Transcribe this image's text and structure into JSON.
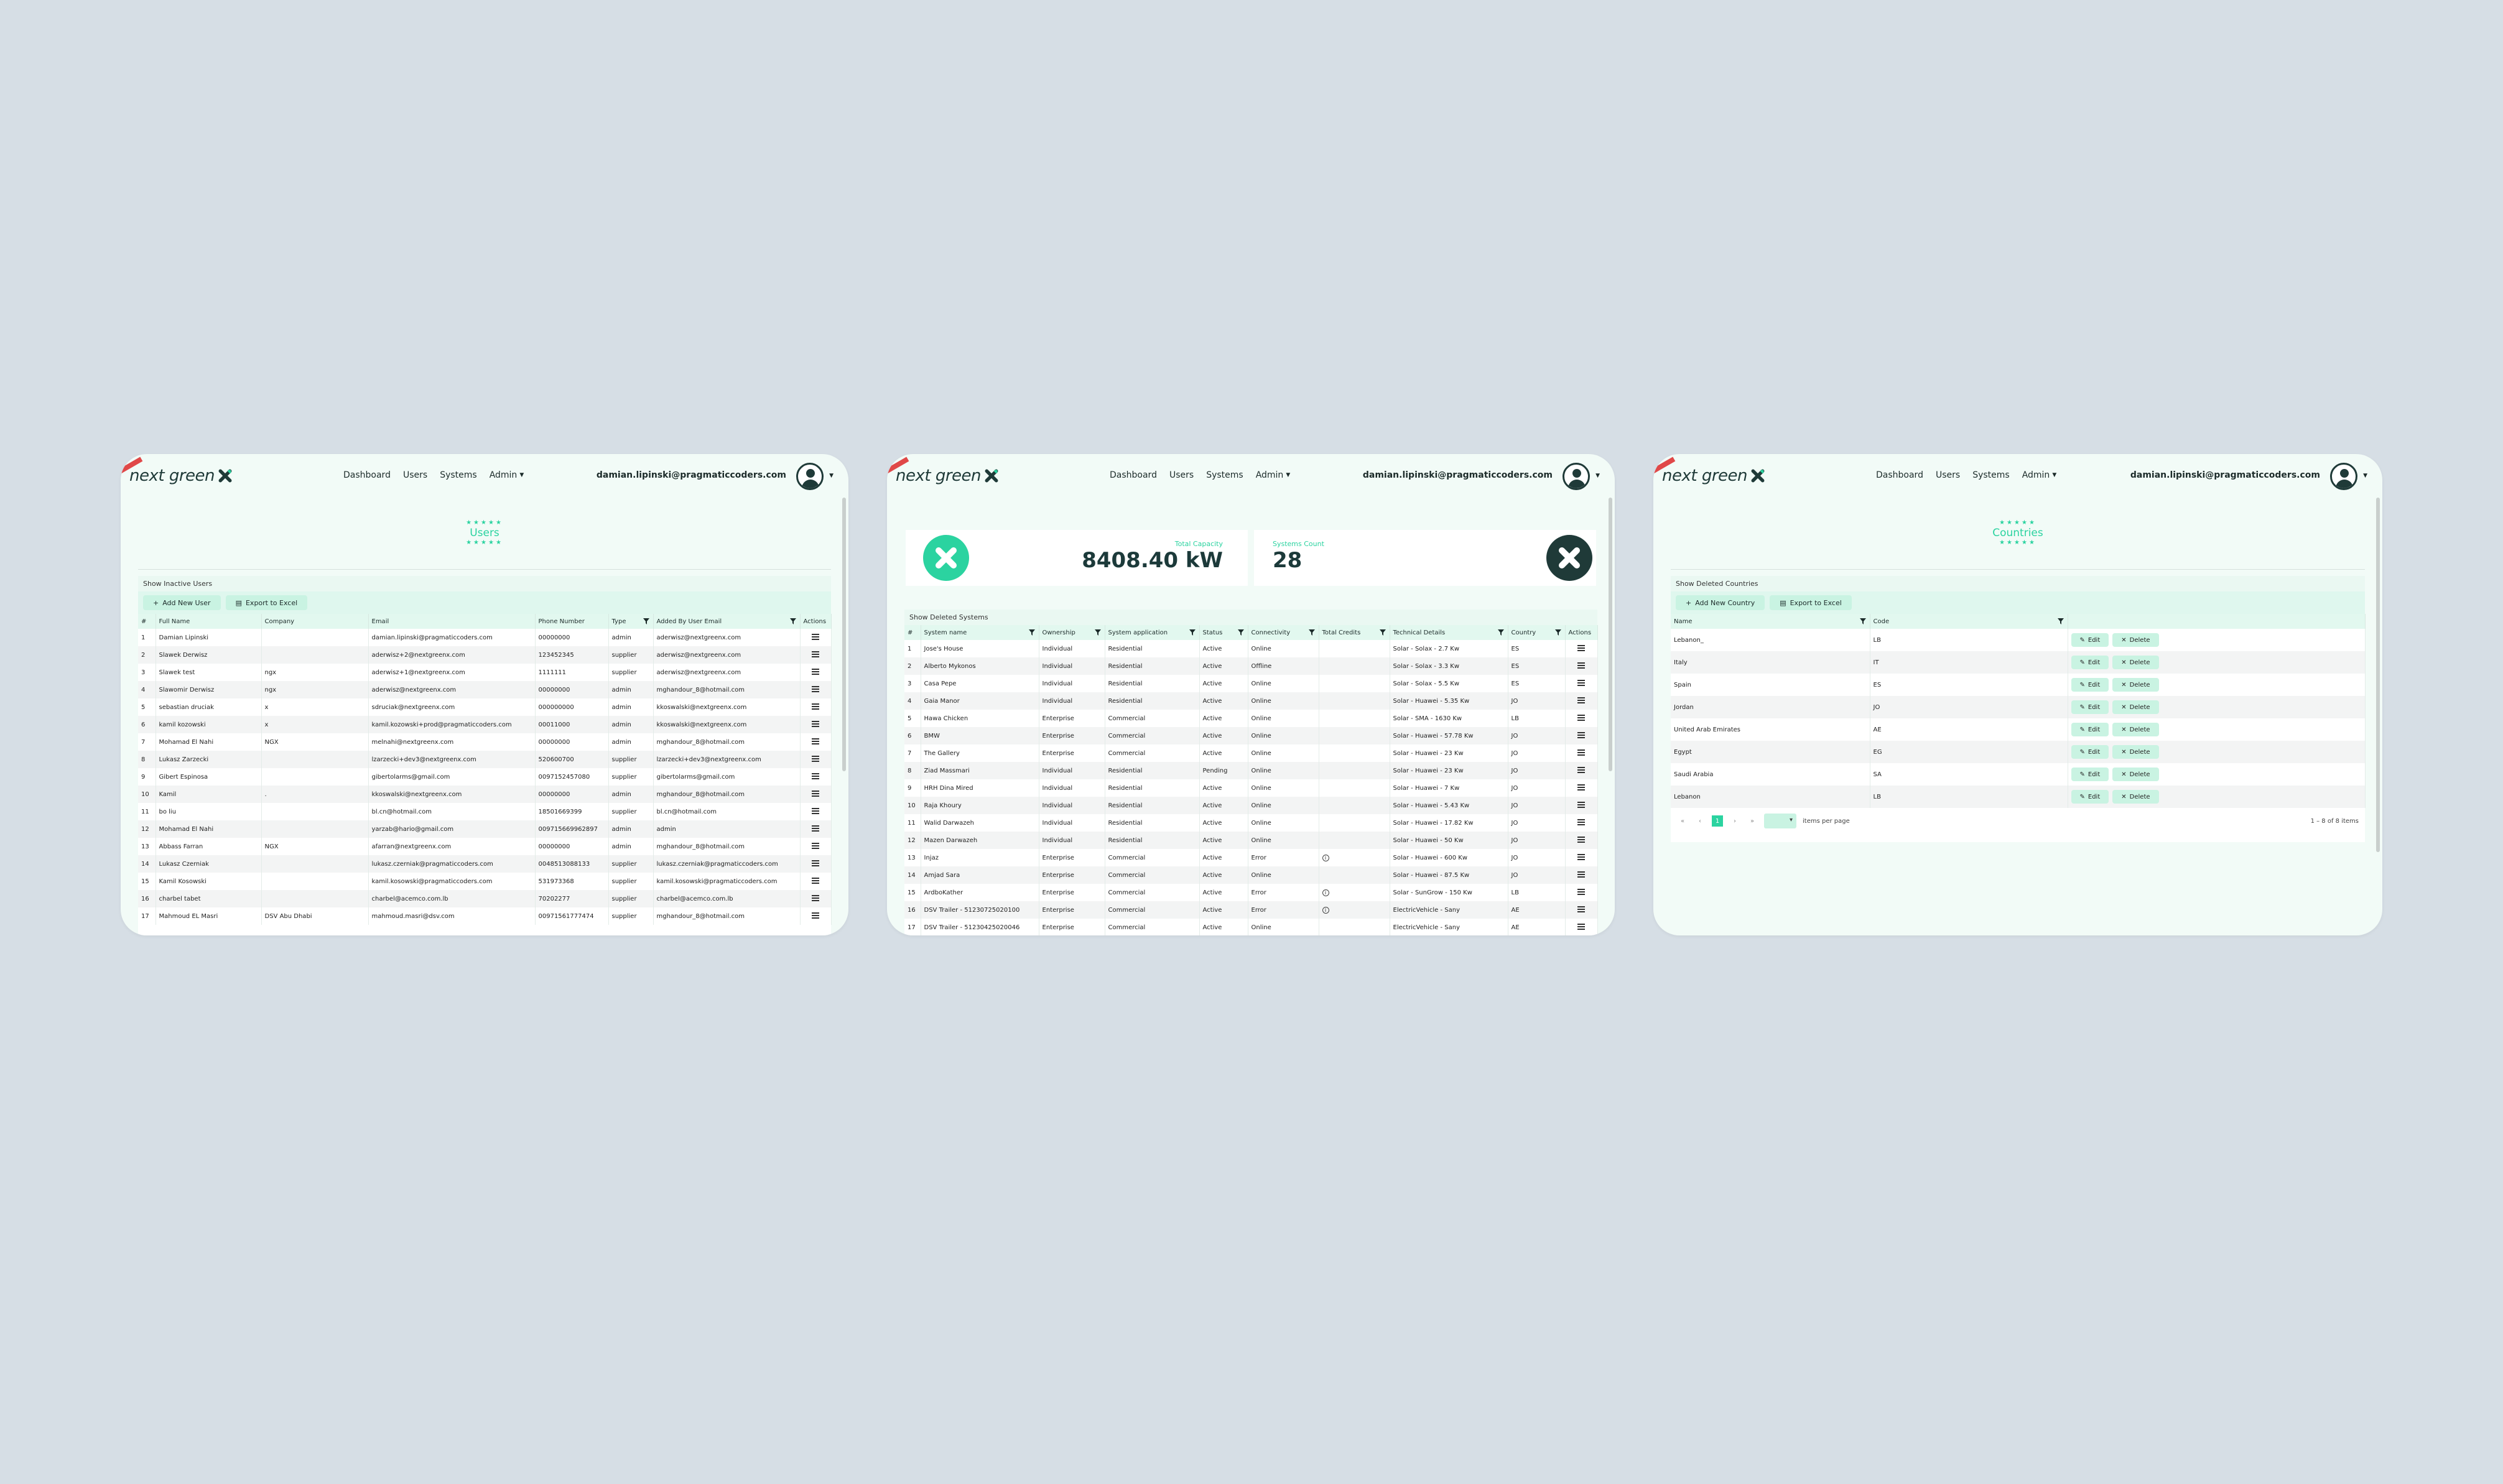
{
  "brand": {
    "logo_text": "next green",
    "accent": "#2bd3a0",
    "dark": "#1f3a38"
  },
  "nav": {
    "items": [
      "Dashboard",
      "Users",
      "Systems",
      "Admin"
    ],
    "user_email": "damian.lipinski@pragmaticcoders.com"
  },
  "users_page": {
    "title": "Users",
    "toggle_label": "Show Inactive Users",
    "add_button": "Add New User",
    "export_button": "Export to Excel",
    "columns": [
      "#",
      "Full Name",
      "Company",
      "Email",
      "Phone Number",
      "Type",
      "Added By User Email",
      "Actions"
    ],
    "rows": [
      [
        "1",
        "Damian Lipinski",
        "",
        "damian.lipinski@pragmaticcoders.com",
        "00000000",
        "admin",
        "aderwisz@nextgreenx.com"
      ],
      [
        "2",
        "Slawek Derwisz",
        "",
        "aderwisz+2@nextgreenx.com",
        "123452345",
        "supplier",
        "aderwisz@nextgreenx.com"
      ],
      [
        "3",
        "Slawek test",
        "ngx",
        "aderwisz+1@nextgreenx.com",
        "1111111",
        "supplier",
        "aderwisz@nextgreenx.com"
      ],
      [
        "4",
        "Slawomir Derwisz",
        "ngx",
        "aderwisz@nextgreenx.com",
        "00000000",
        "admin",
        "mghandour_8@hotmail.com"
      ],
      [
        "5",
        "sebastian druciak",
        "x",
        "sdruciak@nextgreenx.com",
        "000000000",
        "admin",
        "kkoswalski@nextgreenx.com"
      ],
      [
        "6",
        "kamil kozowski",
        "x",
        "kamil.kozowski+prod@pragmaticcoders.com",
        "00011000",
        "admin",
        "kkoswalski@nextgreenx.com"
      ],
      [
        "7",
        "Mohamad El Nahi",
        "NGX",
        "melnahi@nextgreenx.com",
        "00000000",
        "admin",
        "mghandour_8@hotmail.com"
      ],
      [
        "8",
        "Lukasz Zarzecki",
        "",
        "lzarzecki+dev3@nextgreenx.com",
        "520600700",
        "supplier",
        "lzarzecki+dev3@nextgreenx.com"
      ],
      [
        "9",
        "Gibert Espinosa",
        "",
        "gibertolarms@gmail.com",
        "0097152457080",
        "supplier",
        "gibertolarms@gmail.com"
      ],
      [
        "10",
        "Kamil",
        ".",
        "kkoswalski@nextgreenx.com",
        "00000000",
        "admin",
        "mghandour_8@hotmail.com"
      ],
      [
        "11",
        "bo liu",
        "",
        "bl.cn@hotmail.com",
        "18501669399",
        "supplier",
        "bl.cn@hotmail.com"
      ],
      [
        "12",
        "Mohamad El Nahi",
        "",
        "yarzab@hario@gmail.com",
        "009715669962897",
        "admin",
        "admin"
      ],
      [
        "13",
        "Abbass Farran",
        "NGX",
        "afarran@nextgreenx.com",
        "00000000",
        "admin",
        "mghandour_8@hotmail.com"
      ],
      [
        "14",
        "Lukasz Czerniak",
        "",
        "lukasz.czerniak@pragmaticcoders.com",
        "0048513088133",
        "supplier",
        "lukasz.czerniak@pragmaticcoders.com"
      ],
      [
        "15",
        "Kamil Kosowski",
        "",
        "kamil.kosowski@pragmaticcoders.com",
        "531973368",
        "supplier",
        "kamil.kosowski@pragmaticcoders.com"
      ],
      [
        "16",
        "charbel tabet",
        "",
        "charbel@acemco.com.lb",
        "70202277",
        "supplier",
        "charbel@acemco.com.lb"
      ],
      [
        "17",
        "Mahmoud EL Masri",
        "DSV Abu Dhabi",
        "mahmoud.masri@dsv.com",
        "00971561777474",
        "supplier",
        "mghandour_8@hotmail.com"
      ]
    ]
  },
  "systems_page": {
    "total_capacity_label": "Total Capacity",
    "total_capacity_value": "8408.40 kW",
    "systems_count_label": "Systems Count",
    "systems_count_value": "28",
    "toggle_label": "Show Deleted Systems",
    "columns": [
      "#",
      "System name",
      "Ownership",
      "System application",
      "Status",
      "Connectivity",
      "Total Credits",
      "Technical Details",
      "Country",
      "Actions"
    ],
    "rows": [
      [
        "1",
        "Jose's House",
        "Individual",
        "Residential",
        "Active",
        "Online",
        "",
        "Solar - Solax - 2.7 Kw",
        "ES"
      ],
      [
        "2",
        "Alberto Mykonos",
        "Individual",
        "Residential",
        "Active",
        "Offline",
        "",
        "Solar - Solax - 3.3 Kw",
        "ES"
      ],
      [
        "3",
        "Casa Pepe",
        "Individual",
        "Residential",
        "Active",
        "Online",
        "",
        "Solar - Solax - 5.5 Kw",
        "ES"
      ],
      [
        "4",
        "Gaia Manor",
        "Individual",
        "Residential",
        "Active",
        "Online",
        "",
        "Solar - Huawei - 5.35 Kw",
        "JO"
      ],
      [
        "5",
        "Hawa Chicken",
        "Enterprise",
        "Commercial",
        "Active",
        "Online",
        "",
        "Solar - SMA - 1630 Kw",
        "LB"
      ],
      [
        "6",
        "BMW",
        "Enterprise",
        "Commercial",
        "Active",
        "Online",
        "",
        "Solar - Huawei - 57.78 Kw",
        "JO"
      ],
      [
        "7",
        "The Gallery",
        "Enterprise",
        "Commercial",
        "Active",
        "Online",
        "",
        "Solar - Huawei - 23 Kw",
        "JO"
      ],
      [
        "8",
        "Ziad Massmari",
        "Individual",
        "Residential",
        "Pending",
        "Online",
        "",
        "Solar - Huawei - 23 Kw",
        "JO"
      ],
      [
        "9",
        "HRH Dina Mired",
        "Individual",
        "Residential",
        "Active",
        "Online",
        "",
        "Solar - Huawei - 7 Kw",
        "JO"
      ],
      [
        "10",
        "Raja Khoury",
        "Individual",
        "Residential",
        "Active",
        "Online",
        "",
        "Solar - Huawei - 5.43 Kw",
        "JO"
      ],
      [
        "11",
        "Walid Darwazeh",
        "Individual",
        "Residential",
        "Active",
        "Online",
        "",
        "Solar - Huawei - 17.82 Kw",
        "JO"
      ],
      [
        "12",
        "Mazen Darwazeh",
        "Individual",
        "Residential",
        "Active",
        "Online",
        "",
        "Solar - Huawei - 50 Kw",
        "JO"
      ],
      [
        "13",
        "Injaz",
        "Enterprise",
        "Commercial",
        "Active",
        "Error",
        "i",
        "Solar - Huawei - 600 Kw",
        "JO"
      ],
      [
        "14",
        "Amjad Sara",
        "Enterprise",
        "Commercial",
        "Active",
        "Online",
        "",
        "Solar - Huawei - 87.5 Kw",
        "JO"
      ],
      [
        "15",
        "ArdboKather",
        "Enterprise",
        "Commercial",
        "Active",
        "Error",
        "i",
        "Solar - SunGrow - 150 Kw",
        "LB"
      ],
      [
        "16",
        "DSV Trailer - 51230725020100",
        "Enterprise",
        "Commercial",
        "Active",
        "Error",
        "i",
        "ElectricVehicle - Sany",
        "AE"
      ],
      [
        "17",
        "DSV Trailer - 51230425020046",
        "Enterprise",
        "Commercial",
        "Active",
        "Online",
        "",
        "ElectricVehicle - Sany",
        "AE"
      ]
    ]
  },
  "countries_page": {
    "title": "Countries",
    "toggle_label": "Show Deleted Countries",
    "add_button": "Add New Country",
    "export_button": "Export to Excel",
    "columns": [
      "Name",
      "Code"
    ],
    "edit_label": "Edit",
    "delete_label": "Delete",
    "rows": [
      [
        "Lebanon_",
        "LB"
      ],
      [
        "Italy",
        "IT"
      ],
      [
        "Spain",
        "ES"
      ],
      [
        "Jordan",
        "JO"
      ],
      [
        "United Arab Emirates",
        "AE"
      ],
      [
        "Egypt",
        "EG"
      ],
      [
        "Saudi Arabia",
        "SA"
      ],
      [
        "Lebanon",
        "LB"
      ]
    ],
    "pagination": {
      "current_page": "1",
      "items_per_page_label": "items per page",
      "range_text": "1 – 8 of 8 items"
    }
  }
}
